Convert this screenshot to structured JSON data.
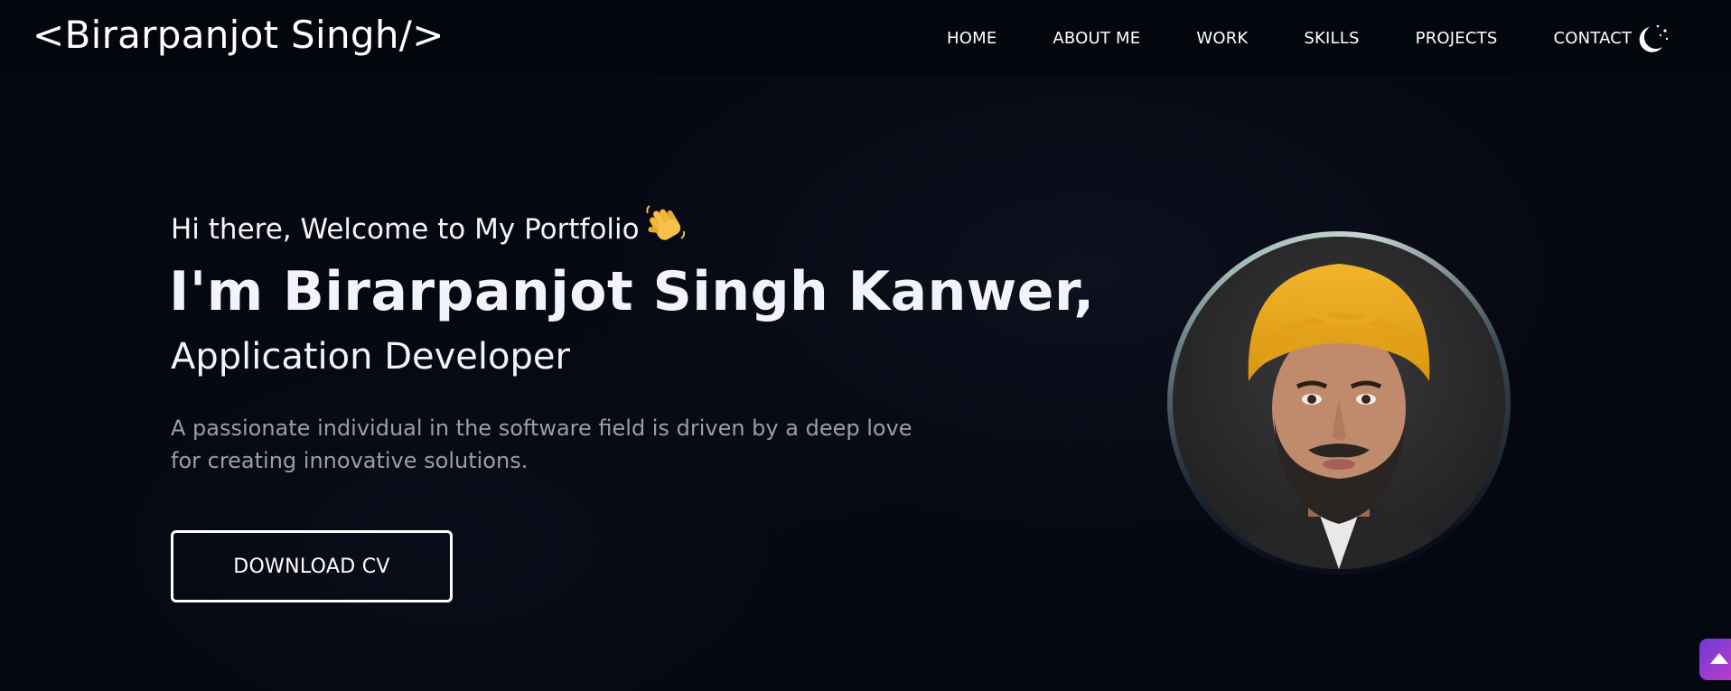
{
  "header": {
    "brand": "<Birarpanjot Singh/>",
    "nav": [
      {
        "label": "HOME"
      },
      {
        "label": "ABOUT ME"
      },
      {
        "label": "WORK"
      },
      {
        "label": "SKILLS"
      },
      {
        "label": "PROJECTS"
      },
      {
        "label": "CONTACT"
      }
    ],
    "theme_toggle_icon": "moon-stars-icon"
  },
  "hero": {
    "greeting": "Hi there, Welcome to My Portfolio",
    "greeting_icon": "waving-hand-icon",
    "headline": "I'm Birarpanjot Singh Kanwer,",
    "role": "Application Developer",
    "description": "A passionate individual in the software field is driven by a deep love for creating innovative solutions.",
    "cta_label": "DOWNLOAD CV"
  },
  "profile_photo": {
    "icon": "profile-photo",
    "ring_color": "#c6d6d3"
  },
  "scroll_top": {
    "icon": "arrow-up-icon",
    "color_start": "#6d3ad6",
    "color_end": "#c23ec9"
  },
  "colors": {
    "background": "#050711",
    "text": "#f3f3fb",
    "muted": "#9d9da7"
  }
}
